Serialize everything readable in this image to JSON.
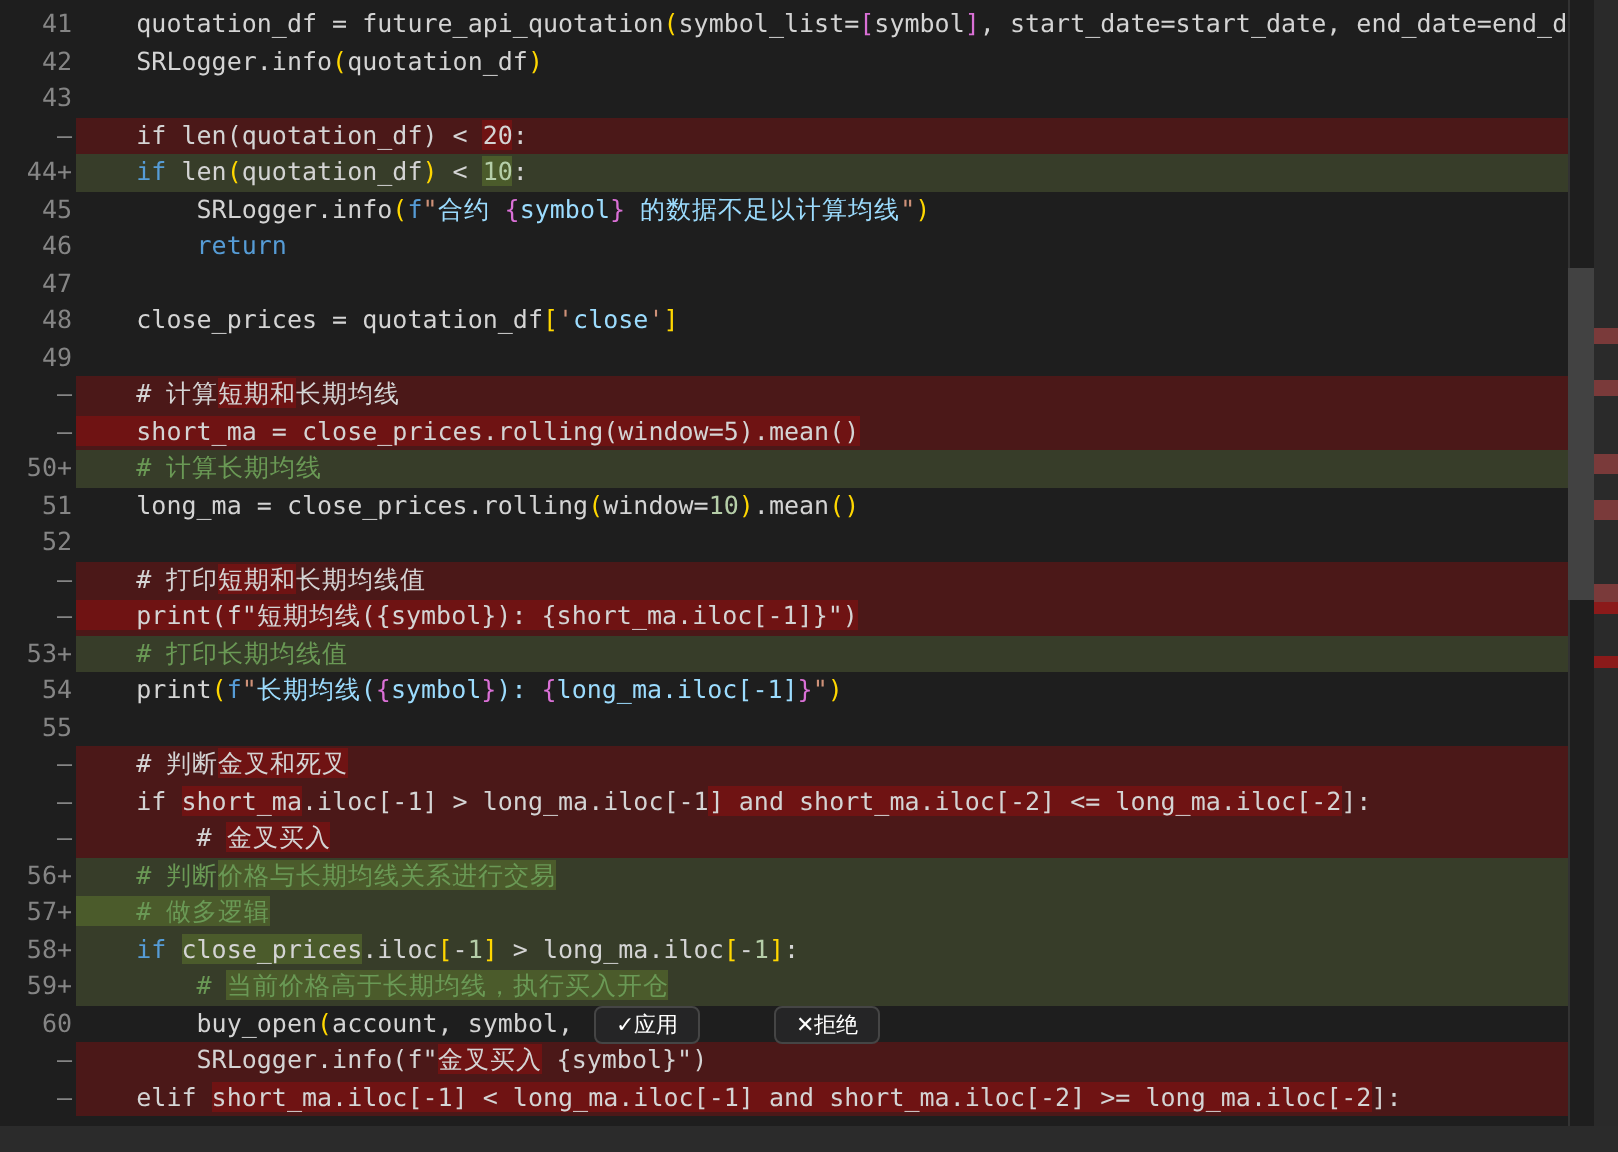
{
  "lines": [
    {
      "kind": "normal",
      "gutter": "41",
      "text": "    quotation_df = future_api_quotation(symbol_list=[symbol], start_date=start_date, end_date=end_d"
    },
    {
      "kind": "normal",
      "gutter": "42",
      "text": "    SRLogger.info(quotation_df)"
    },
    {
      "kind": "normal",
      "gutter": "43"
    },
    {
      "kind": "removed",
      "gutter": "—",
      "segments": [
        {
          "text": "    if len(quotation_df) < ",
          "changed": false
        },
        {
          "text": "20",
          "changed": true
        },
        {
          "text": ":",
          "changed": false
        }
      ]
    },
    {
      "kind": "added",
      "gutter": "44+",
      "segments": [
        {
          "text": "    if len(quotation_df) < ",
          "changed": false
        },
        {
          "text": "10",
          "changed": true
        },
        {
          "text": ":",
          "changed": false
        }
      ]
    },
    {
      "kind": "normal",
      "gutter": "45",
      "text": "        SRLogger.info(f\"合约 {symbol} 的数据不足以计算均线\")"
    },
    {
      "kind": "normal",
      "gutter": "46",
      "text": "        return"
    },
    {
      "kind": "normal",
      "gutter": "47"
    },
    {
      "kind": "normal",
      "gutter": "48",
      "text": "    close_prices = quotation_df['close']"
    },
    {
      "kind": "normal",
      "gutter": "49"
    },
    {
      "kind": "removed",
      "gutter": "—",
      "segments": [
        {
          "text": "    # 计算",
          "changed": false
        },
        {
          "text": "短期和",
          "changed": true
        },
        {
          "text": "长期均线",
          "changed": false
        }
      ]
    },
    {
      "kind": "removed",
      "gutter": "—",
      "segments": [
        {
          "text": "    short_ma = close_prices.rolling(window=5).mean()",
          "changed": true
        }
      ]
    },
    {
      "kind": "added",
      "gutter": "50+",
      "segments": [
        {
          "text": "    # 计算长期均线",
          "changed": false
        }
      ]
    },
    {
      "kind": "normal",
      "gutter": "51",
      "text": "    long_ma = close_prices.rolling(window=10).mean()"
    },
    {
      "kind": "normal",
      "gutter": "52"
    },
    {
      "kind": "removed",
      "gutter": "—",
      "segments": [
        {
          "text": "    # 打印",
          "changed": false
        },
        {
          "text": "短期和",
          "changed": true
        },
        {
          "text": "长期均线值",
          "changed": false
        }
      ]
    },
    {
      "kind": "removed",
      "gutter": "—",
      "segments": [
        {
          "text": "    print(f\"短期均线({symbol}): {short_ma.iloc[-1]}\")",
          "changed": true
        }
      ]
    },
    {
      "kind": "added",
      "gutter": "53+",
      "segments": [
        {
          "text": "    # 打印长期均线值",
          "changed": false
        }
      ]
    },
    {
      "kind": "normal",
      "gutter": "54",
      "text": "    print(f\"长期均线({symbol}): {long_ma.iloc[-1]}\")"
    },
    {
      "kind": "normal",
      "gutter": "55"
    },
    {
      "kind": "removed",
      "gutter": "—",
      "segments": [
        {
          "text": "    # 判断",
          "changed": false
        },
        {
          "text": "金叉和死叉",
          "changed": true
        }
      ]
    },
    {
      "kind": "removed",
      "gutter": "—",
      "segments": [
        {
          "text": "    if ",
          "changed": false
        },
        {
          "text": "short_ma",
          "changed": true
        },
        {
          "text": ".iloc[-1] > long_ma.iloc[-1",
          "changed": false
        },
        {
          "text": "] and short_ma.iloc[-2] <= long_ma.iloc[-2",
          "changed": true
        },
        {
          "text": "]:",
          "changed": false
        }
      ]
    },
    {
      "kind": "removed",
      "gutter": "—",
      "segments": [
        {
          "text": "        # ",
          "changed": false
        },
        {
          "text": "金叉买入",
          "changed": true
        }
      ]
    },
    {
      "kind": "added",
      "gutter": "56+",
      "segments": [
        {
          "text": "    # 判断",
          "changed": false
        },
        {
          "text": "价格与长期均线关系进行交易",
          "changed": true
        }
      ]
    },
    {
      "kind": "added",
      "gutter": "57+",
      "segments": [
        {
          "text": "    # 做多逻辑",
          "changed": true
        }
      ]
    },
    {
      "kind": "added",
      "gutter": "58+",
      "segments": [
        {
          "text": "    if ",
          "changed": false
        },
        {
          "text": "close_prices",
          "changed": true
        },
        {
          "text": ".iloc[-1] > long_ma.iloc[-1]:",
          "changed": false
        }
      ]
    },
    {
      "kind": "added",
      "gutter": "59+",
      "segments": [
        {
          "text": "        # ",
          "changed": false
        },
        {
          "text": "当前价格高于长期均线，执行买入开仓",
          "changed": true
        }
      ]
    },
    {
      "kind": "normal",
      "gutter": "60",
      "text": "        buy_open(account, symbol,"
    },
    {
      "kind": "removed",
      "gutter": "—",
      "segments": [
        {
          "text": "        SRLogger.info(f\"",
          "changed": false
        },
        {
          "text": "金叉买入",
          "changed": true
        },
        {
          "text": " {symbol}\")",
          "changed": false
        }
      ]
    },
    {
      "kind": "removed",
      "gutter": "—",
      "segments": [
        {
          "text": "    elif ",
          "changed": false
        },
        {
          "text": "short_ma.iloc[-1] < long_ma.iloc[-1] and short_ma.iloc[-2] >= long_ma.iloc[-2",
          "changed": true
        },
        {
          "text": "]:",
          "changed": false
        }
      ]
    }
  ],
  "actions": [
    {
      "kind": "accept",
      "label": "✓应用"
    },
    {
      "kind": "reject",
      "label": "✕拒绝"
    }
  ]
}
